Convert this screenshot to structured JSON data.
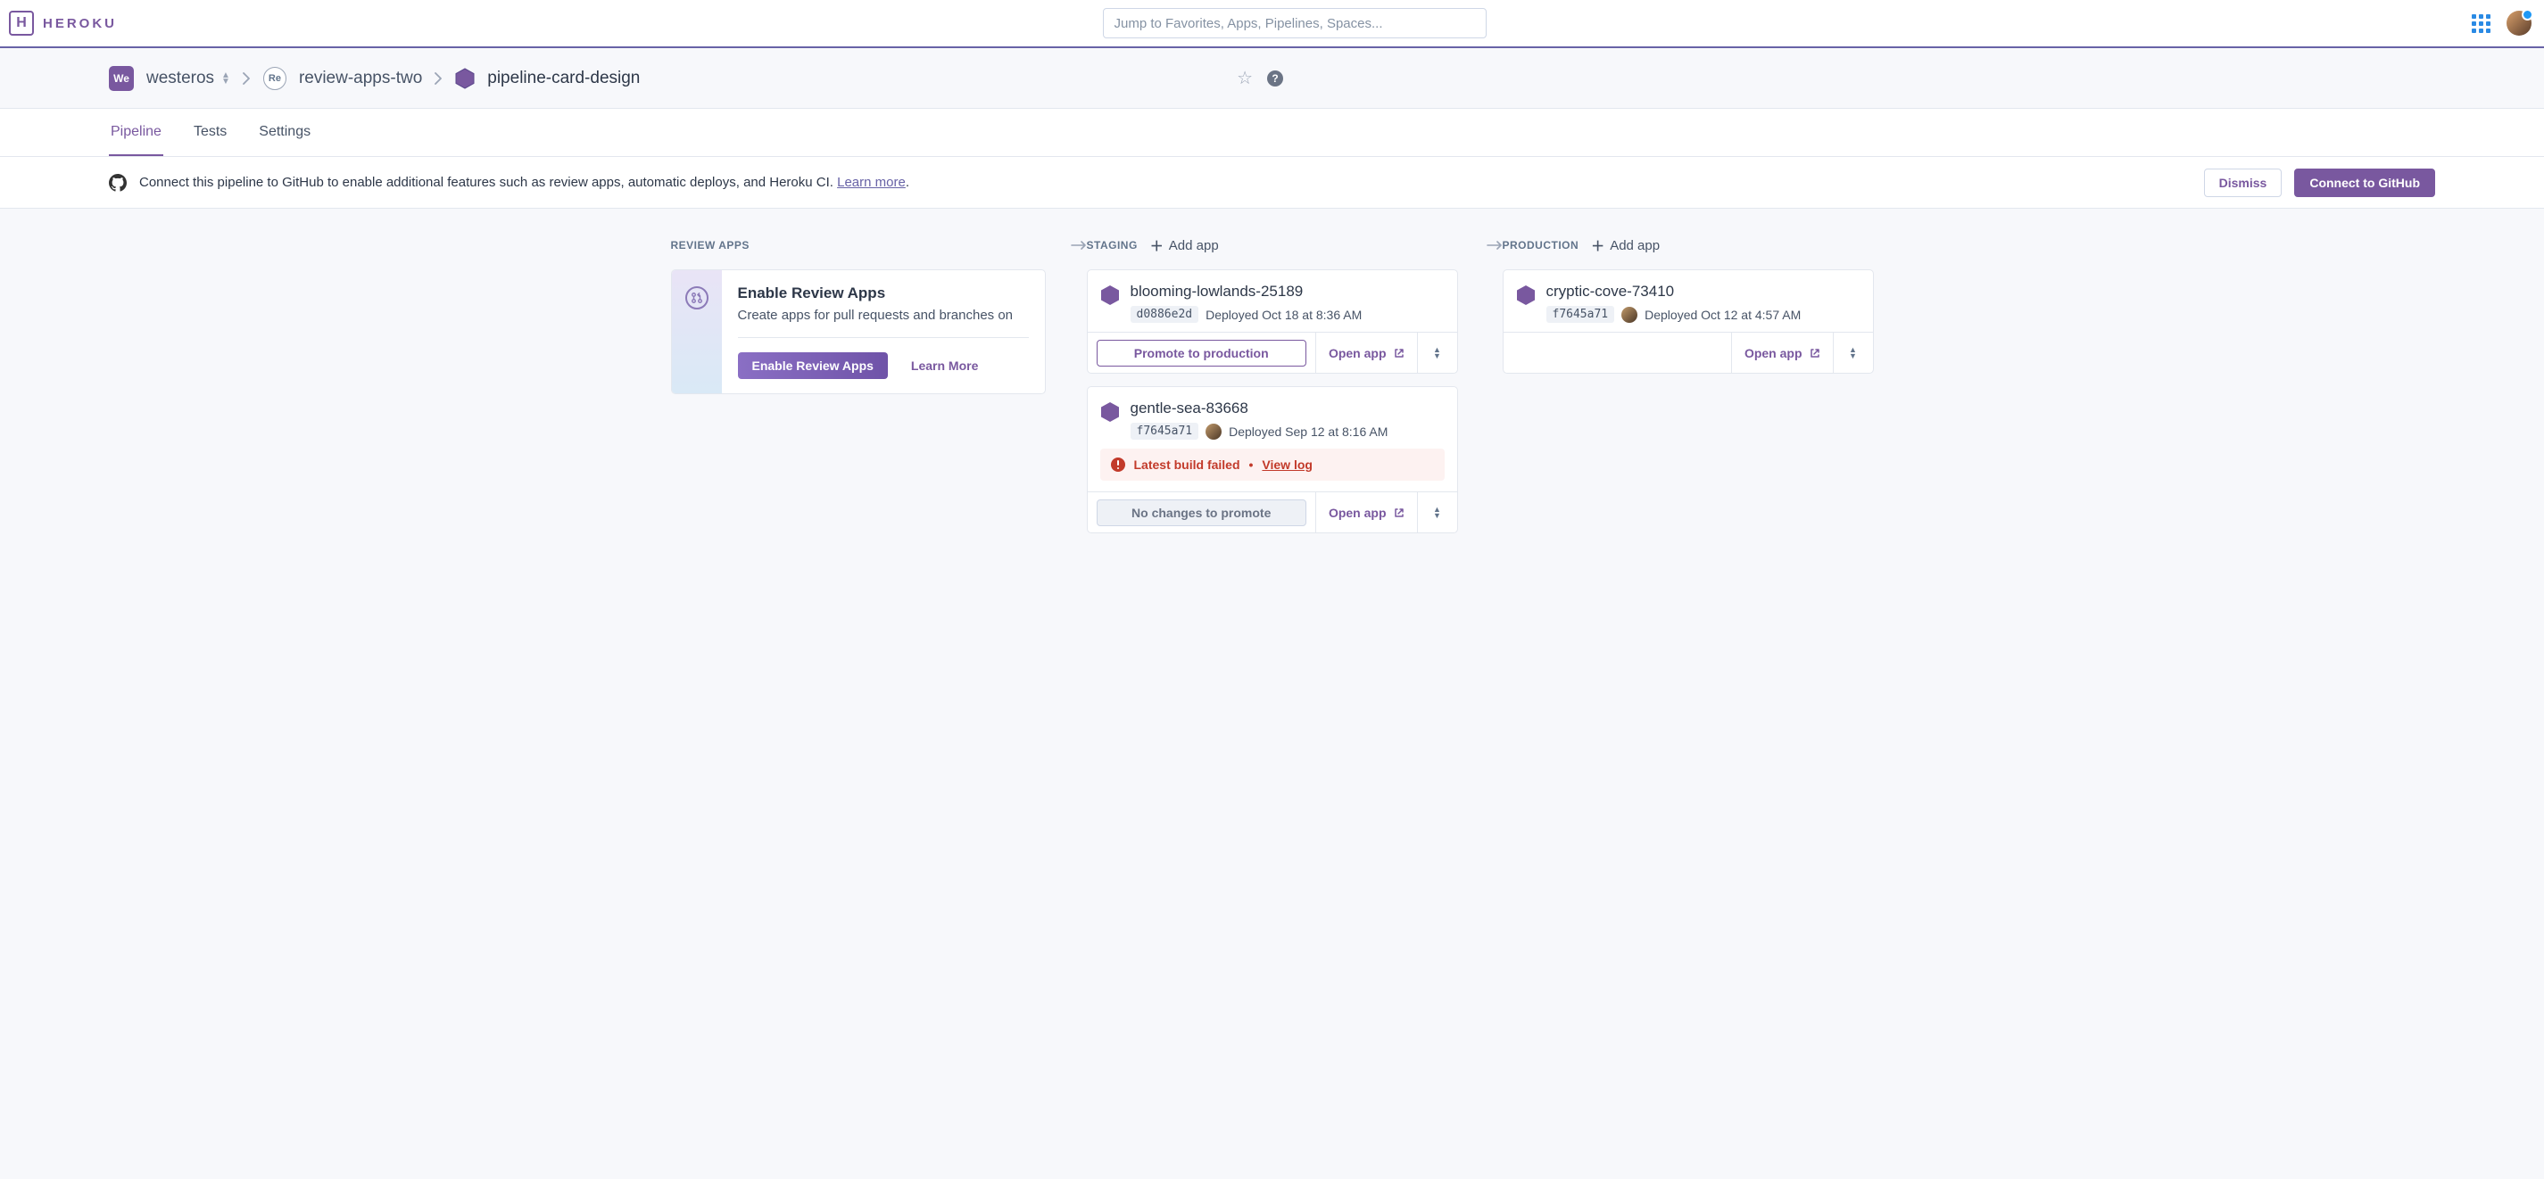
{
  "brand": {
    "name": "HEROKU"
  },
  "search": {
    "placeholder": "Jump to Favorites, Apps, Pipelines, Spaces..."
  },
  "breadcrumb": {
    "team_badge": "We",
    "team": "westeros",
    "space_badge": "Re",
    "space": "review-apps-two",
    "current": "pipeline-card-design"
  },
  "tabs": {
    "pipeline": "Pipeline",
    "tests": "Tests",
    "settings": "Settings"
  },
  "banner": {
    "text_prefix": "Connect this pipeline to GitHub to enable additional features such as review apps, automatic deploys, and Heroku CI. ",
    "learn_more": "Learn more",
    "dismiss": "Dismiss",
    "connect": "Connect to GitHub"
  },
  "columns": {
    "review": {
      "title": "REVIEW APPS",
      "promo_title": "Enable Review Apps",
      "promo_desc": "Create apps for pull requests and branches on",
      "enable_btn": "Enable Review Apps",
      "learn_more": "Learn More"
    },
    "staging": {
      "title": "STAGING",
      "add_app": "Add app",
      "apps": [
        {
          "name": "blooming-lowlands-25189",
          "sha": "d0886e2d",
          "deployed": "Deployed Oct 18 at 8:36 AM",
          "show_avatar": false,
          "error": null,
          "promote_label": "Promote to production",
          "promote_disabled": false,
          "open_label": "Open app"
        },
        {
          "name": "gentle-sea-83668",
          "sha": "f7645a71",
          "deployed": "Deployed Sep 12 at 8:16 AM",
          "show_avatar": true,
          "error": {
            "text": "Latest build failed",
            "link": "View log"
          },
          "promote_label": "No changes to promote",
          "promote_disabled": true,
          "open_label": "Open app"
        }
      ]
    },
    "production": {
      "title": "PRODUCTION",
      "add_app": "Add app",
      "apps": [
        {
          "name": "cryptic-cove-73410",
          "sha": "f7645a71",
          "deployed": "Deployed Oct 12 at 4:57 AM",
          "show_avatar": true,
          "error": null,
          "open_label": "Open app"
        }
      ]
    }
  }
}
